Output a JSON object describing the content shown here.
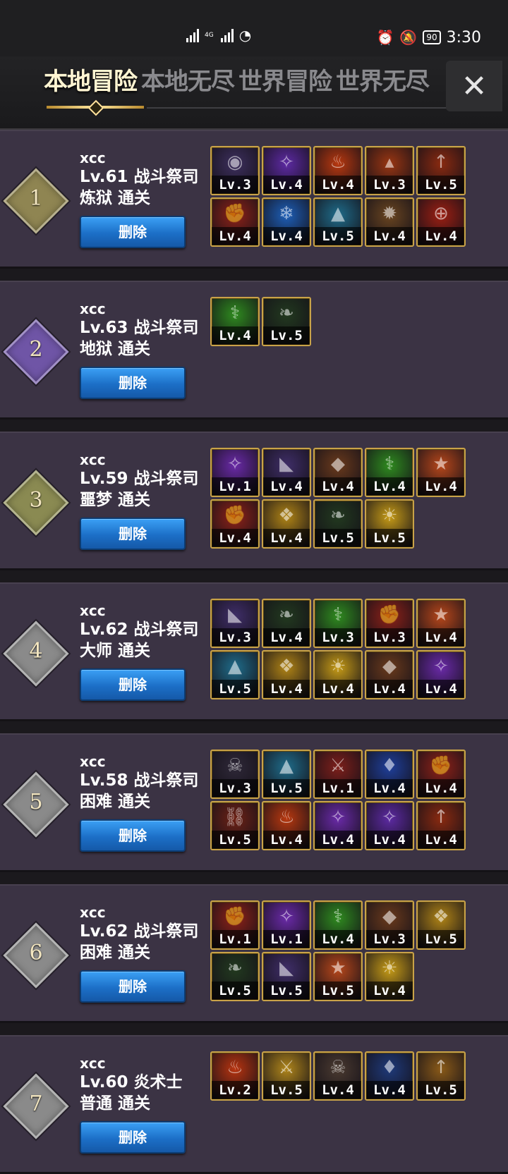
{
  "status_bar": {
    "network": "4G",
    "battery": "90",
    "time": "3:30"
  },
  "header": {
    "tabs": [
      {
        "label": "本地冒险",
        "active": true
      },
      {
        "label": "本地无尽",
        "active": false
      },
      {
        "label": "世界冒险",
        "active": false
      },
      {
        "label": "世界无尽",
        "active": false
      }
    ],
    "close_label": "✕"
  },
  "delete_label": "删除",
  "records": [
    {
      "rank": "1",
      "rank_color": "#8f8552",
      "name": "xcc",
      "level": "Lv.61",
      "class": "战斗祭司",
      "difficulty": "炼狱",
      "status": "通关",
      "skills": [
        {
          "lv": "Lv.3",
          "color": "#3d2f5e",
          "icon": "shadow-hand-icon"
        },
        {
          "lv": "Lv.4",
          "color": "#5d2aa3",
          "icon": "purple-slash-icon"
        },
        {
          "lv": "Lv.4",
          "color": "#b8380f",
          "icon": "fire-icon"
        },
        {
          "lv": "Lv.3",
          "color": "#9a3612",
          "icon": "fire-helmet-icon"
        },
        {
          "lv": "Lv.5",
          "color": "#8a2a10",
          "icon": "fire-spear-icon"
        },
        {
          "lv": "Lv.4",
          "color": "#8f2218",
          "icon": "red-fist-icon"
        },
        {
          "lv": "Lv.4",
          "color": "#1d5fb8",
          "icon": "ice-burst-icon"
        },
        {
          "lv": "Lv.5",
          "color": "#1f6c8a",
          "icon": "ice-spikes-icon"
        },
        {
          "lv": "Lv.4",
          "color": "#6a4520",
          "icon": "gold-burst-icon"
        },
        {
          "lv": "Lv.4",
          "color": "#9d1f12",
          "icon": "red-shield-icon"
        }
      ]
    },
    {
      "rank": "2",
      "rank_color": "#6f55a6",
      "name": "xcc",
      "level": "Lv.63",
      "class": "战斗祭司",
      "difficulty": "地狱",
      "status": "通关",
      "skills": [
        {
          "lv": "Lv.4",
          "color": "#2f8b1f",
          "icon": "green-totem-icon"
        },
        {
          "lv": "Lv.5",
          "color": "#22391f",
          "icon": "vines-icon"
        }
      ]
    },
    {
      "rank": "3",
      "rank_color": "#8a8a52",
      "name": "xcc",
      "level": "Lv.59",
      "class": "战斗祭司",
      "difficulty": "噩梦",
      "status": "通关",
      "skills": [
        {
          "lv": "Lv.1",
          "color": "#6a2aa8",
          "icon": "purple-slash-icon"
        },
        {
          "lv": "Lv.4",
          "color": "#3f2e68",
          "icon": "purple-cape-icon"
        },
        {
          "lv": "Lv.4",
          "color": "#6a3a1c",
          "icon": "bronze-shield-icon"
        },
        {
          "lv": "Lv.4",
          "color": "#2f8b1f",
          "icon": "green-totem-icon"
        },
        {
          "lv": "Lv.4",
          "color": "#b7471a",
          "icon": "orange-shield-icon"
        },
        {
          "lv": "Lv.4",
          "color": "#8f2218",
          "icon": "red-fist-icon"
        },
        {
          "lv": "Lv.4",
          "color": "#b08416",
          "icon": "gold-wings-icon"
        },
        {
          "lv": "Lv.5",
          "color": "#22391f",
          "icon": "vines-icon"
        },
        {
          "lv": "Lv.5",
          "color": "#c79c17",
          "icon": "holy-light-icon"
        }
      ]
    },
    {
      "rank": "4",
      "rank_color": "#8a8a8a",
      "name": "xcc",
      "level": "Lv.62",
      "class": "战斗祭司",
      "difficulty": "大师",
      "status": "通关",
      "skills": [
        {
          "lv": "Lv.3",
          "color": "#3f2e68",
          "icon": "purple-cape-icon"
        },
        {
          "lv": "Lv.4",
          "color": "#22391f",
          "icon": "vines-icon"
        },
        {
          "lv": "Lv.3",
          "color": "#2f8b1f",
          "icon": "green-totem-icon"
        },
        {
          "lv": "Lv.3",
          "color": "#8f2218",
          "icon": "red-fist-icon"
        },
        {
          "lv": "Lv.4",
          "color": "#b7471a",
          "icon": "orange-shield-icon"
        },
        {
          "lv": "Lv.5",
          "color": "#1f6c8a",
          "icon": "ice-spikes-icon"
        },
        {
          "lv": "Lv.4",
          "color": "#b08416",
          "icon": "gold-wings-icon"
        },
        {
          "lv": "Lv.4",
          "color": "#c79c17",
          "icon": "holy-light-icon"
        },
        {
          "lv": "Lv.4",
          "color": "#6a3a1c",
          "icon": "bronze-shield-icon"
        },
        {
          "lv": "Lv.4",
          "color": "#6a2aa8",
          "icon": "purple-slash-icon"
        }
      ]
    },
    {
      "rank": "5",
      "rank_color": "#8a8a8a",
      "name": "xcc",
      "level": "Lv.58",
      "class": "战斗祭司",
      "difficulty": "困难",
      "status": "通关",
      "skills": [
        {
          "lv": "Lv.3",
          "color": "#2e2838",
          "icon": "dark-reaper-icon"
        },
        {
          "lv": "Lv.5",
          "color": "#1f6c8a",
          "icon": "ice-spikes-icon"
        },
        {
          "lv": "Lv.1",
          "color": "#7d1f1a",
          "icon": "red-axe-icon"
        },
        {
          "lv": "Lv.4",
          "color": "#1f3f9a",
          "icon": "blue-crystal-icon"
        },
        {
          "lv": "Lv.4",
          "color": "#8f2218",
          "icon": "red-fist-icon"
        },
        {
          "lv": "Lv.5",
          "color": "#6e2216",
          "icon": "chains-icon"
        },
        {
          "lv": "Lv.4",
          "color": "#b8380f",
          "icon": "fire-icon"
        },
        {
          "lv": "Lv.4",
          "color": "#6a2aa8",
          "icon": "purple-slash-icon"
        },
        {
          "lv": "Lv.4",
          "color": "#5d2aa3",
          "icon": "purple-slash-icon"
        },
        {
          "lv": "Lv.4",
          "color": "#8a2a10",
          "icon": "fire-spear-icon"
        }
      ]
    },
    {
      "rank": "6",
      "rank_color": "#8a8a8a",
      "name": "xcc",
      "level": "Lv.62",
      "class": "战斗祭司",
      "difficulty": "困难",
      "status": "通关",
      "skills": [
        {
          "lv": "Lv.1",
          "color": "#8f2218",
          "icon": "red-fist-icon"
        },
        {
          "lv": "Lv.1",
          "color": "#6a2aa8",
          "icon": "purple-slash-icon"
        },
        {
          "lv": "Lv.4",
          "color": "#2f8b1f",
          "icon": "green-totem-icon"
        },
        {
          "lv": "Lv.3",
          "color": "#6a3a1c",
          "icon": "bronze-shield-icon"
        },
        {
          "lv": "Lv.5",
          "color": "#b08416",
          "icon": "gold-wings-icon"
        },
        {
          "lv": "Lv.5",
          "color": "#22391f",
          "icon": "vines-icon"
        },
        {
          "lv": "Lv.5",
          "color": "#3f2e68",
          "icon": "purple-cape-icon"
        },
        {
          "lv": "Lv.5",
          "color": "#b7471a",
          "icon": "orange-shield-icon"
        },
        {
          "lv": "Lv.4",
          "color": "#c79c17",
          "icon": "holy-light-icon"
        }
      ]
    },
    {
      "rank": "7",
      "rank_color": "#8a8a8a",
      "name": "xcc",
      "level": "Lv.60",
      "class": "炎术士",
      "difficulty": "普通",
      "status": "通关",
      "skills": [
        {
          "lv": "Lv.2",
          "color": "#b8340f",
          "icon": "fire-wings-icon"
        },
        {
          "lv": "Lv.5",
          "color": "#b0861a",
          "icon": "gold-blade-icon"
        },
        {
          "lv": "Lv.4",
          "color": "#4a3a30",
          "icon": "demon-icon"
        },
        {
          "lv": "Lv.4",
          "color": "#1f3a7a",
          "icon": "blue-warrior-icon"
        },
        {
          "lv": "Lv.5",
          "color": "#8a5a18",
          "icon": "gold-dagger-icon"
        }
      ]
    }
  ]
}
